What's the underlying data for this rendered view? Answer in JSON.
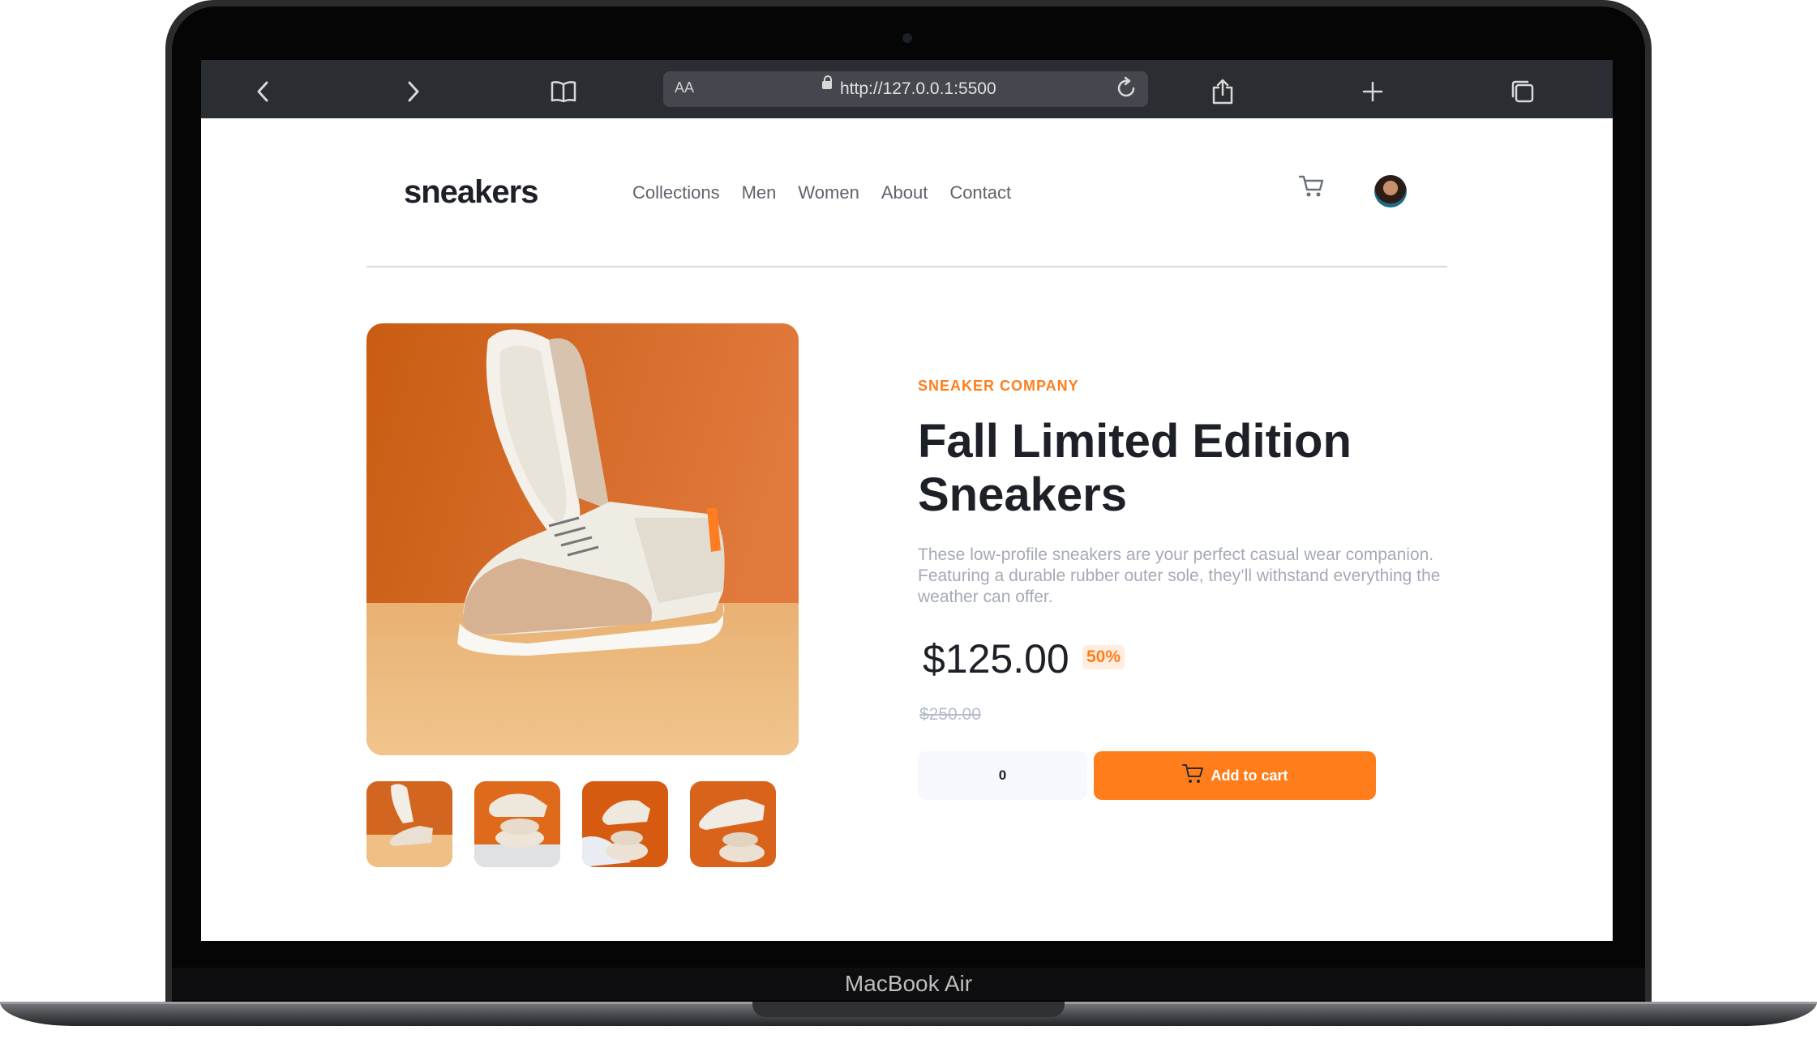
{
  "device": {
    "label": "MacBook Air"
  },
  "browser": {
    "address_aa": "AA",
    "url": "http://127.0.0.1:5500"
  },
  "page": {
    "logo": "sneakers",
    "nav": [
      "Collections",
      "Men",
      "Women",
      "About",
      "Contact"
    ],
    "product": {
      "company": "SNEAKER COMPANY",
      "title": "Fall Limited Edition Sneakers",
      "description": "These low-profile sneakers are your perfect casual wear companion. Featuring a durable rubber outer sole, they’ll withstand everything the weather can offer.",
      "price": "$125.00",
      "discount": "50%",
      "old_price": "$250.00",
      "quantity": "0",
      "add_to_cart": "Add to cart"
    }
  },
  "colors": {
    "accent": "#ff7e1b",
    "accent_pale": "#ffede0",
    "dark": "#1d2026",
    "grey": "#a5aab5"
  }
}
